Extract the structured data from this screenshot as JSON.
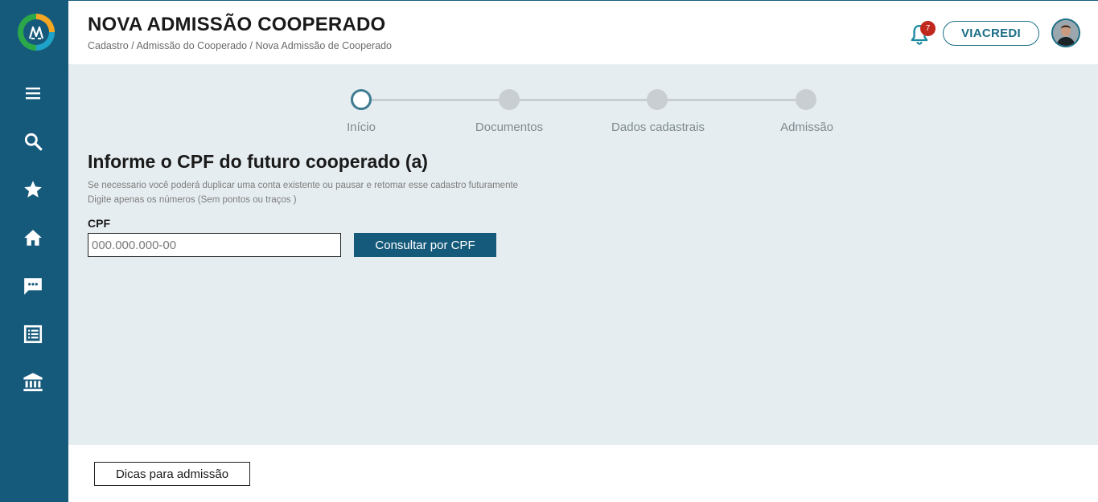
{
  "header": {
    "title": "NOVA ADMISSÃO COOPERADO",
    "breadcrumb": "Cadastro / Admissão do Cooperado / Nova Admissão de Cooperado",
    "notification_count": "7",
    "org_label": "VIACREDI"
  },
  "sidebar": {
    "items": [
      {
        "icon": "menu-icon"
      },
      {
        "icon": "search-icon"
      },
      {
        "icon": "star-icon"
      },
      {
        "icon": "home-icon"
      },
      {
        "icon": "chat-icon"
      },
      {
        "icon": "list-icon"
      },
      {
        "icon": "bank-icon"
      }
    ]
  },
  "stepper": {
    "steps": [
      {
        "label": "Início",
        "active": true
      },
      {
        "label": "Documentos",
        "active": false
      },
      {
        "label": "Dados cadastrais",
        "active": false
      },
      {
        "label": "Admissão",
        "active": false
      }
    ]
  },
  "form": {
    "title": "Informe o CPF do futuro cooperado (a)",
    "hint_1": "Se necessario você poderá duplicar uma conta existente ou pausar e retomar esse cadastro futuramente",
    "hint_2": "Digite apenas os números (Sem pontos ou traços )",
    "cpf_label": "CPF",
    "cpf_placeholder": "000.000.000-00",
    "cpf_value": "",
    "consult_button": "Consultar por CPF"
  },
  "footer": {
    "tips_button": "Dicas para admissão"
  },
  "colors": {
    "sidebar": "#165a7b",
    "accent": "#1b6e87",
    "content_bg": "#e6edf0",
    "badge": "#c0281e"
  }
}
